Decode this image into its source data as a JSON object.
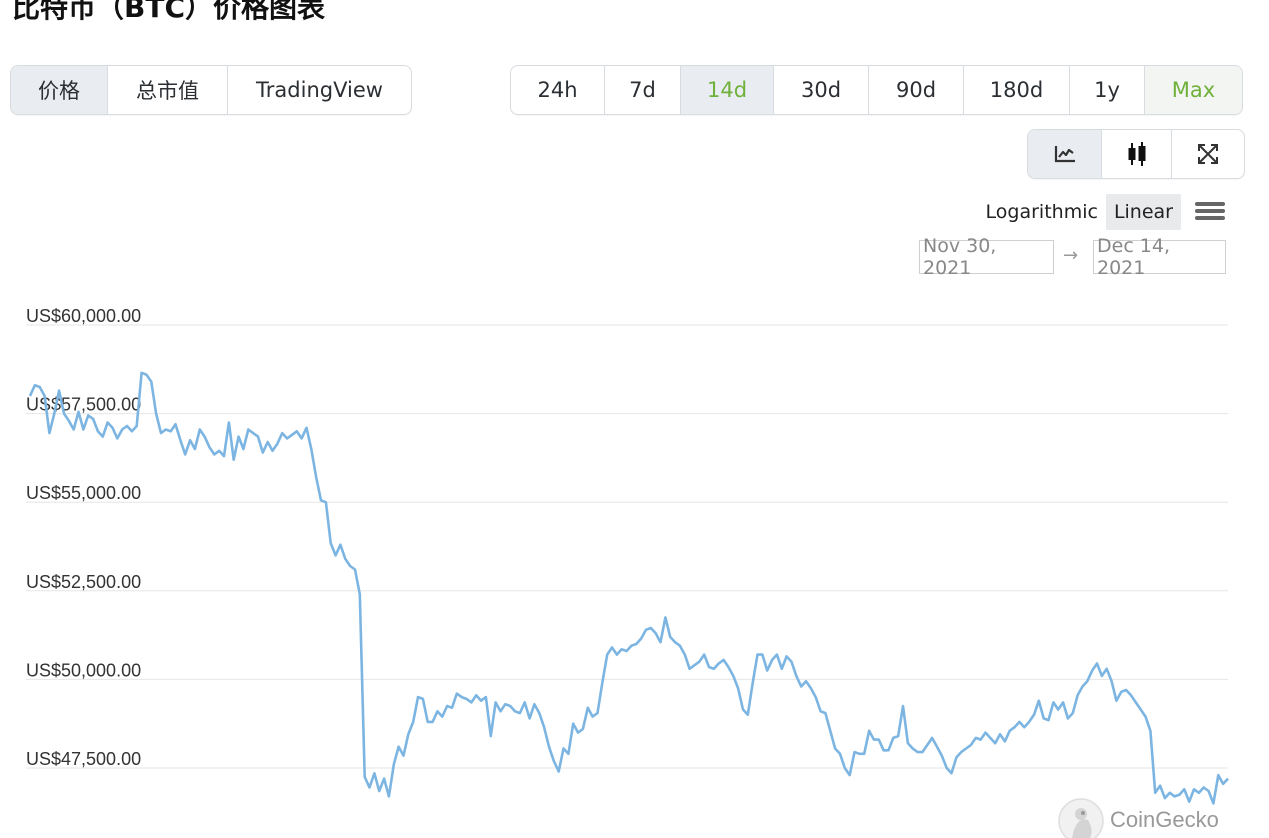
{
  "page": {
    "title": "比特币（BTC）价格图表"
  },
  "metric_tabs": [
    {
      "label": "价格",
      "active": true
    },
    {
      "label": "总市值",
      "active": false
    },
    {
      "label": "TradingView",
      "active": false
    }
  ],
  "range_tabs": [
    {
      "label": "24h",
      "active": false,
      "color": "#2b2f33"
    },
    {
      "label": "7d",
      "active": false,
      "color": "#2b2f33"
    },
    {
      "label": "14d",
      "active": true,
      "color": "#6fb13b"
    },
    {
      "label": "30d",
      "active": false,
      "color": "#2b2f33"
    },
    {
      "label": "90d",
      "active": false,
      "color": "#2b2f33"
    },
    {
      "label": "180d",
      "active": false,
      "color": "#2b2f33"
    },
    {
      "label": "1y",
      "active": false,
      "color": "#2b2f33"
    },
    {
      "label": "Max",
      "active": false,
      "color": "#6fb13b"
    }
  ],
  "chart_tools": [
    {
      "icon": "line-chart-icon",
      "active": true
    },
    {
      "icon": "candlestick-icon",
      "active": false
    },
    {
      "icon": "expand-icon",
      "active": false
    }
  ],
  "scale": {
    "logarithmic": "Logarithmic",
    "linear": "Linear",
    "selected": "Linear"
  },
  "menu_icon": "hamburger-menu-icon",
  "date_range": {
    "from": "Nov 30, 2021",
    "arrow": "→",
    "to": "Dec 14, 2021"
  },
  "watermark": {
    "text": "CoinGecko",
    "icon": "coingecko-gecko-icon"
  },
  "colors": {
    "accent_green": "#6fb13b",
    "line": "#7cb5e2",
    "grid": "#e6e6e6"
  },
  "chart_data": {
    "type": "line",
    "series": [
      {
        "values": [
          58000,
          58300,
          58250,
          58000,
          56950,
          57500,
          58150,
          57500,
          57300,
          57050,
          57550,
          57050,
          57450,
          57350,
          57000,
          56850,
          57250,
          57100,
          56800,
          57050,
          57150,
          57000,
          57150,
          58650,
          58600,
          58400,
          57500,
          56950,
          57050,
          57000,
          57200,
          56750,
          56350,
          56750,
          56500,
          57050,
          56850,
          56550,
          56350,
          56450,
          56300,
          57250,
          56200,
          56850,
          56500,
          57050,
          56950,
          56850,
          56400,
          56700,
          56450,
          56650,
          56950,
          56800,
          56900,
          57000,
          56800,
          57100,
          56500,
          55700,
          55050,
          55000,
          53850,
          53500,
          53800,
          53400,
          53200,
          53100,
          52400,
          47250,
          46950,
          47350,
          46850,
          47200,
          46700,
          47600,
          48100,
          47850,
          48450,
          48800,
          49500,
          49450,
          48800,
          48800,
          49100,
          48950,
          49250,
          49200,
          49600,
          49500,
          49450,
          49350,
          49550,
          49400,
          49500,
          48400,
          49350,
          49100,
          49300,
          49250,
          49100,
          49050,
          49350,
          48900,
          49300,
          49050,
          48650,
          48100,
          47700,
          47400,
          48050,
          47900,
          48750,
          48500,
          48600,
          49200,
          48950,
          49050,
          49900,
          50700,
          50900,
          50700,
          50850,
          50800,
          50950,
          51000,
          51150,
          51400,
          51450,
          51300,
          51050,
          51750,
          51200,
          51050,
          50950,
          50700,
          50300,
          50400,
          50500,
          50700,
          50350,
          50300,
          50450,
          50550,
          50350,
          50100,
          49750,
          49150,
          49000,
          49900,
          50700,
          50700,
          50250,
          50550,
          50700,
          50300,
          50650,
          50500,
          50100,
          49800,
          49950,
          49750,
          49500,
          49100,
          49050,
          48550,
          48050,
          47900,
          47500,
          47300,
          47950,
          47900,
          47900,
          48550,
          48300,
          48300,
          48000,
          48000,
          48350,
          48400,
          49250,
          48200,
          48050,
          47950,
          47950,
          48150,
          48350,
          48100,
          47850,
          47500,
          47350,
          47800,
          47950,
          48050,
          48150,
          48350,
          48300,
          48500,
          48350,
          48200,
          48450,
          48250,
          48550,
          48650,
          48800,
          48650,
          48800,
          49000,
          49400,
          48900,
          48850,
          49350,
          49150,
          49350,
          48900,
          49050,
          49550,
          49800,
          49950,
          50250,
          50450,
          50100,
          50300,
          49950,
          49400,
          49650,
          49700,
          49550,
          49350,
          49150,
          48950,
          48550,
          46800,
          47000,
          46650,
          46800,
          46700,
          46750,
          46900,
          46550,
          46900,
          46800,
          46950,
          46850,
          46500,
          47300,
          47050,
          47200
        ]
      }
    ],
    "yticks": [
      "US$47,500.00",
      "US$50,000.00",
      "US$52,500.00",
      "US$55,000.00",
      "US$57,500.00",
      "US$60,000.00"
    ],
    "ytick_values": [
      47500,
      50000,
      52500,
      55000,
      57500,
      60000
    ],
    "ylim": [
      46000,
      60000
    ],
    "grid": true,
    "xlabel": "",
    "ylabel": ""
  }
}
